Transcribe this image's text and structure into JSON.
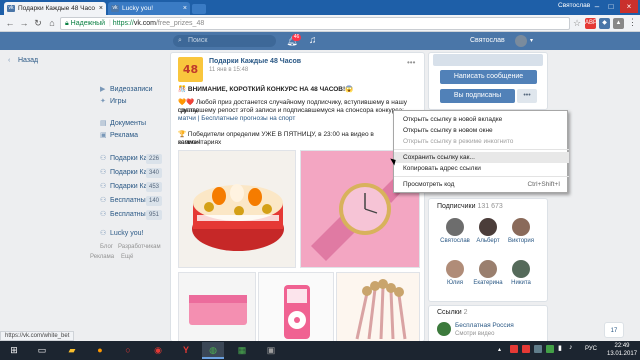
{
  "browser": {
    "tabs": [
      {
        "title": "Подарки Каждые 48 Часо",
        "active": true
      },
      {
        "title": "Lucky you!",
        "active": false
      }
    ],
    "url_secure_label": "Надежный",
    "url_protocol": "https://",
    "url_host": "vk.com",
    "url_path": "/free_prizes_48",
    "user_name_tab": "Святослав",
    "status_url": "https://vk.com/white_bet"
  },
  "header": {
    "search_placeholder": "Поиск",
    "notifications_count": "46",
    "profile_name": "Святослав"
  },
  "sidebar": {
    "items": [
      {
        "label": "Назад",
        "icon": "back-icon"
      },
      {
        "label": "Видеозаписи",
        "icon": "video-icon"
      },
      {
        "label": "Игры",
        "icon": "games-icon"
      },
      {
        "label": "Документы",
        "icon": "documents-icon"
      },
      {
        "label": "Реклама",
        "icon": "ads-icon"
      },
      {
        "label": "Подарки Каж",
        "count": "226"
      },
      {
        "label": "Подарки Каж",
        "count": "340"
      },
      {
        "label": "Подарки Каж",
        "count": "453"
      },
      {
        "label": "Бесплатные",
        "count": "140"
      },
      {
        "label": "Бесплатные",
        "count": "951"
      },
      {
        "label": "Lucky you!"
      }
    ],
    "footer_links": [
      "Блог",
      "Разработчикам",
      "Реклама",
      "Ещё"
    ]
  },
  "post": {
    "author": "Подарки Каждые 48 Часов",
    "date": "11 янв в 15:48",
    "avatar_text": "48",
    "line1": "🎊 ВНИМАНИЕ, КОРОТКИЙ КОНКУРС НА 48 ЧАСОВ!😱",
    "line2": "🧡❤️ Любой приз достанется случайному подписчику, вступившему в нашу группу,",
    "line3": "сделавшему репост этой записи и подписавшемуся на спонсора конкурса:",
    "line4": "матчи | Бесплатные прогнозы на спорт",
    "line5": "🏆 Победители определим УЖЕ В ПЯТНИЦУ, в 23:00 на видео в комментариях",
    "line6": "записи!"
  },
  "right": {
    "send_message": "Написать сообщение",
    "subscribed": "Вы подписаны",
    "subscribers_title": "Подписчики",
    "subscribers_count": "131 673",
    "subscribers": [
      "Святослав",
      "Альберт",
      "Виктория",
      "Юлия",
      "Екатерина",
      "Никита"
    ],
    "links_title": "Ссылки",
    "links_count": "2",
    "links_item": "Бесплатная Россия",
    "links_item_sub": "Смотри видео"
  },
  "context_menu": {
    "items": [
      {
        "label": "Открыть ссылку в новой вкладке",
        "disabled": false
      },
      {
        "label": "Открыть ссылку в новом окне",
        "disabled": false
      },
      {
        "label": "Открыть ссылку в режиме инкогнито",
        "disabled": true
      },
      {
        "label": "Сохранить ссылку как...",
        "disabled": false,
        "hover": true
      },
      {
        "label": "Копировать адрес ссылки",
        "disabled": false
      },
      {
        "label": "Просмотреть код",
        "shortcut": "Ctrl+Shift+I",
        "disabled": false
      }
    ]
  },
  "chat": {
    "label": "17"
  },
  "taskbar": {
    "lang": "РУС",
    "time": "22:49",
    "date": "13.01.2017"
  }
}
